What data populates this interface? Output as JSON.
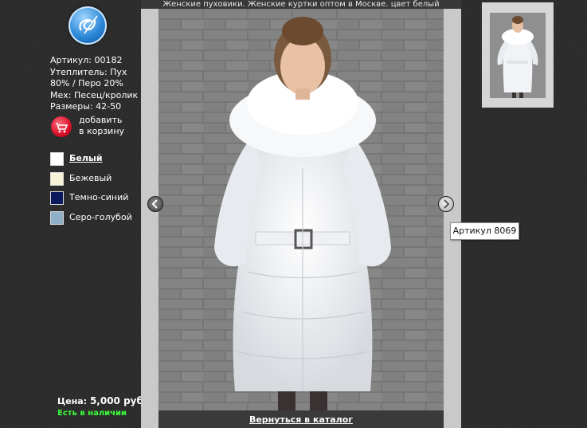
{
  "caption": "Женские пуховики. Женские куртки оптом в Москве. цвет белый",
  "product": {
    "article": "Артикул: 00182",
    "insulation_1": "Утеплитель: Пух",
    "insulation_2": "80% / Перо 20%",
    "fur": "Мех: Песец/кролик",
    "sizes": "Размеры: 42-50"
  },
  "cart": {
    "label_1": "добавить",
    "label_2": "в корзину"
  },
  "colors": [
    {
      "name": "Белый",
      "hex": "#ffffff",
      "active": true
    },
    {
      "name": "Бежевый",
      "hex": "#f7f2d8",
      "active": false
    },
    {
      "name": "Темно-синий",
      "hex": "#0a1a5c",
      "active": false
    },
    {
      "name": "Серо-голубой",
      "hex": "#8fb0c6",
      "active": false
    }
  ],
  "price": {
    "label": "Цена:",
    "value": "5,000 руб."
  },
  "stock": "Есть в наличии",
  "back_link": "Вернуться в каталог",
  "tooltip": "Артикул 8069",
  "icons": {
    "logo": "logo-icon",
    "cart": "cart-icon",
    "prev": "arrow-left-icon",
    "next": "arrow-right-icon"
  }
}
